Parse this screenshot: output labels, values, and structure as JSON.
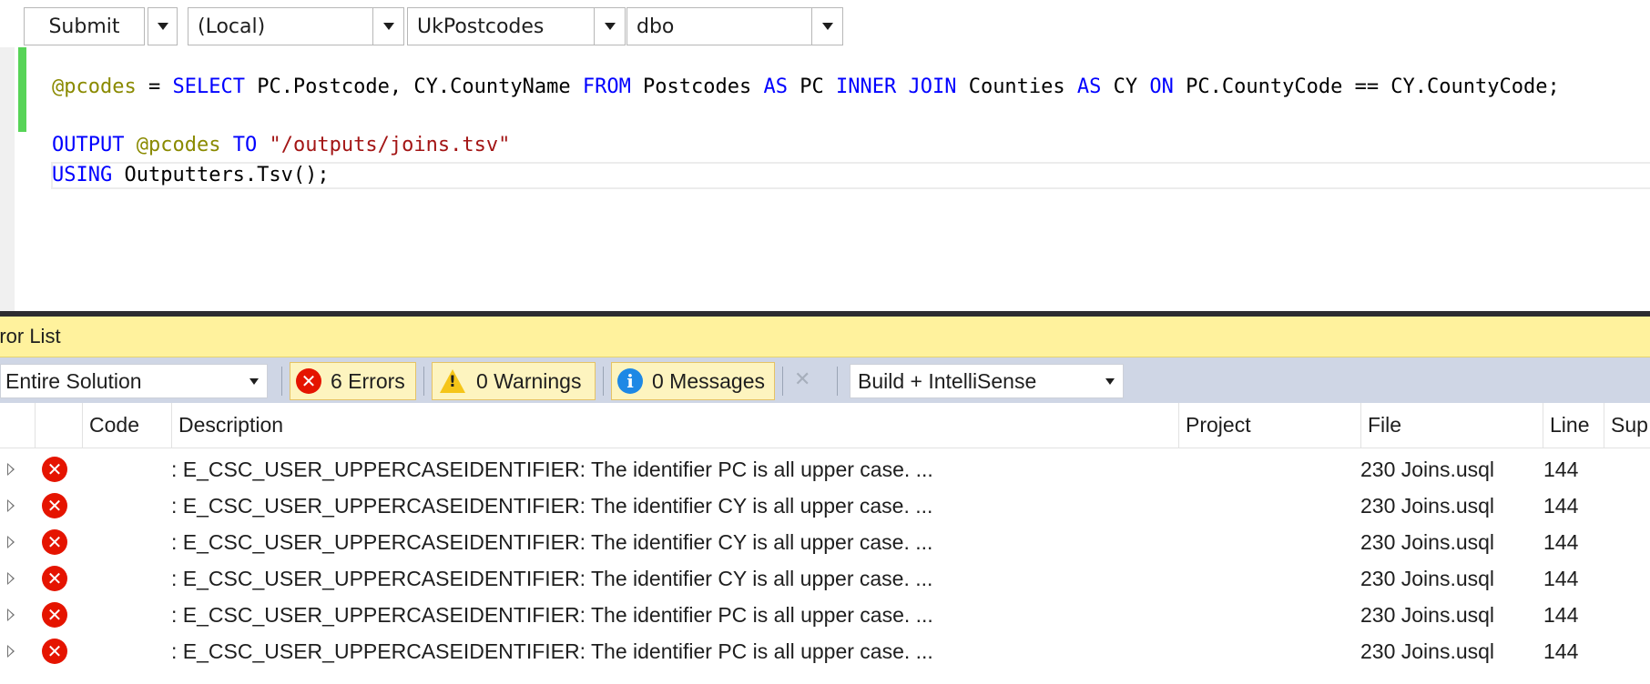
{
  "toolbar": {
    "submit_label": "Submit",
    "server": "(Local)",
    "database": "UkPostcodes",
    "schema": "dbo"
  },
  "editor": {
    "lines": [
      [
        {
          "t": "@pcodes",
          "c": "var"
        },
        {
          "t": " = ",
          "c": ""
        },
        {
          "t": "SELECT",
          "c": "kw"
        },
        {
          "t": " PC.Postcode, CY.CountyName ",
          "c": ""
        },
        {
          "t": "FROM",
          "c": "kw"
        },
        {
          "t": " Postcodes ",
          "c": ""
        },
        {
          "t": "AS",
          "c": "kw"
        },
        {
          "t": " PC ",
          "c": ""
        },
        {
          "t": "INNER JOIN",
          "c": "kw"
        },
        {
          "t": " Counties ",
          "c": ""
        },
        {
          "t": "AS",
          "c": "kw"
        },
        {
          "t": " CY ",
          "c": ""
        },
        {
          "t": "ON",
          "c": "kw"
        },
        {
          "t": " PC.CountyCode == CY.CountyCode;",
          "c": ""
        }
      ],
      [],
      [
        {
          "t": "OUTPUT",
          "c": "kw"
        },
        {
          "t": " ",
          "c": ""
        },
        {
          "t": "@pcodes",
          "c": "var"
        },
        {
          "t": " ",
          "c": ""
        },
        {
          "t": "TO",
          "c": "kw"
        },
        {
          "t": " ",
          "c": ""
        },
        {
          "t": "\"/outputs/joins.tsv\"",
          "c": "str"
        }
      ],
      [
        {
          "t": "USING",
          "c": "kw"
        },
        {
          "t": " Outputters.Tsv();",
          "c": ""
        }
      ]
    ]
  },
  "error_list": {
    "title": "rror List",
    "scope": "Entire Solution",
    "errors_label": "6 Errors",
    "warnings_label": "0 Warnings",
    "messages_label": "0 Messages",
    "build_filter": "Build + IntelliSense",
    "columns": [
      "Code",
      "Description",
      "Project",
      "File",
      "Line",
      "Sup"
    ],
    "rows": [
      {
        "description": ": E_CSC_USER_UPPERCASEIDENTIFIER: The identifier PC is all upper case. ...",
        "file": "230 Joins.usql",
        "line": "144"
      },
      {
        "description": ": E_CSC_USER_UPPERCASEIDENTIFIER: The identifier CY is all upper case. ...",
        "file": "230 Joins.usql",
        "line": "144"
      },
      {
        "description": ": E_CSC_USER_UPPERCASEIDENTIFIER: The identifier CY is all upper case. ...",
        "file": "230 Joins.usql",
        "line": "144"
      },
      {
        "description": ": E_CSC_USER_UPPERCASEIDENTIFIER: The identifier CY is all upper case. ...",
        "file": "230 Joins.usql",
        "line": "144"
      },
      {
        "description": ": E_CSC_USER_UPPERCASEIDENTIFIER: The identifier PC is all upper case. ...",
        "file": "230 Joins.usql",
        "line": "144"
      },
      {
        "description": ": E_CSC_USER_UPPERCASEIDENTIFIER: The identifier PC is all upper case. ...",
        "file": "230 Joins.usql",
        "line": "144"
      }
    ]
  },
  "colors": {
    "keyword": "#0000ff",
    "variable": "#8a8a00",
    "string": "#a31515",
    "error_icon": "#e51400",
    "warning_icon": "#f5c518",
    "info_icon": "#1e88e5",
    "panel_title_bg": "#fff29d"
  },
  "icons": [
    "chevron-down-icon",
    "error-icon",
    "warning-icon",
    "info-icon",
    "clear-filter-icon",
    "expand-arrow-icon"
  ]
}
